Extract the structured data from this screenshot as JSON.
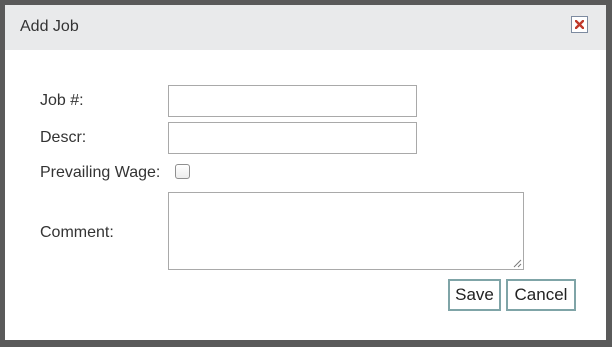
{
  "dialog": {
    "title": "Add Job",
    "close_icon": "close-x-icon",
    "close_icon_color": "#c0392b"
  },
  "form": {
    "job_label": "Job #:",
    "job_value": "",
    "descr_label": "Descr:",
    "descr_value": "",
    "prevailing_wage_label": "Prevailing Wage:",
    "prevailing_wage_checked": false,
    "comment_label": "Comment:",
    "comment_value": ""
  },
  "buttons": {
    "save_label": "Save",
    "cancel_label": "Cancel"
  }
}
